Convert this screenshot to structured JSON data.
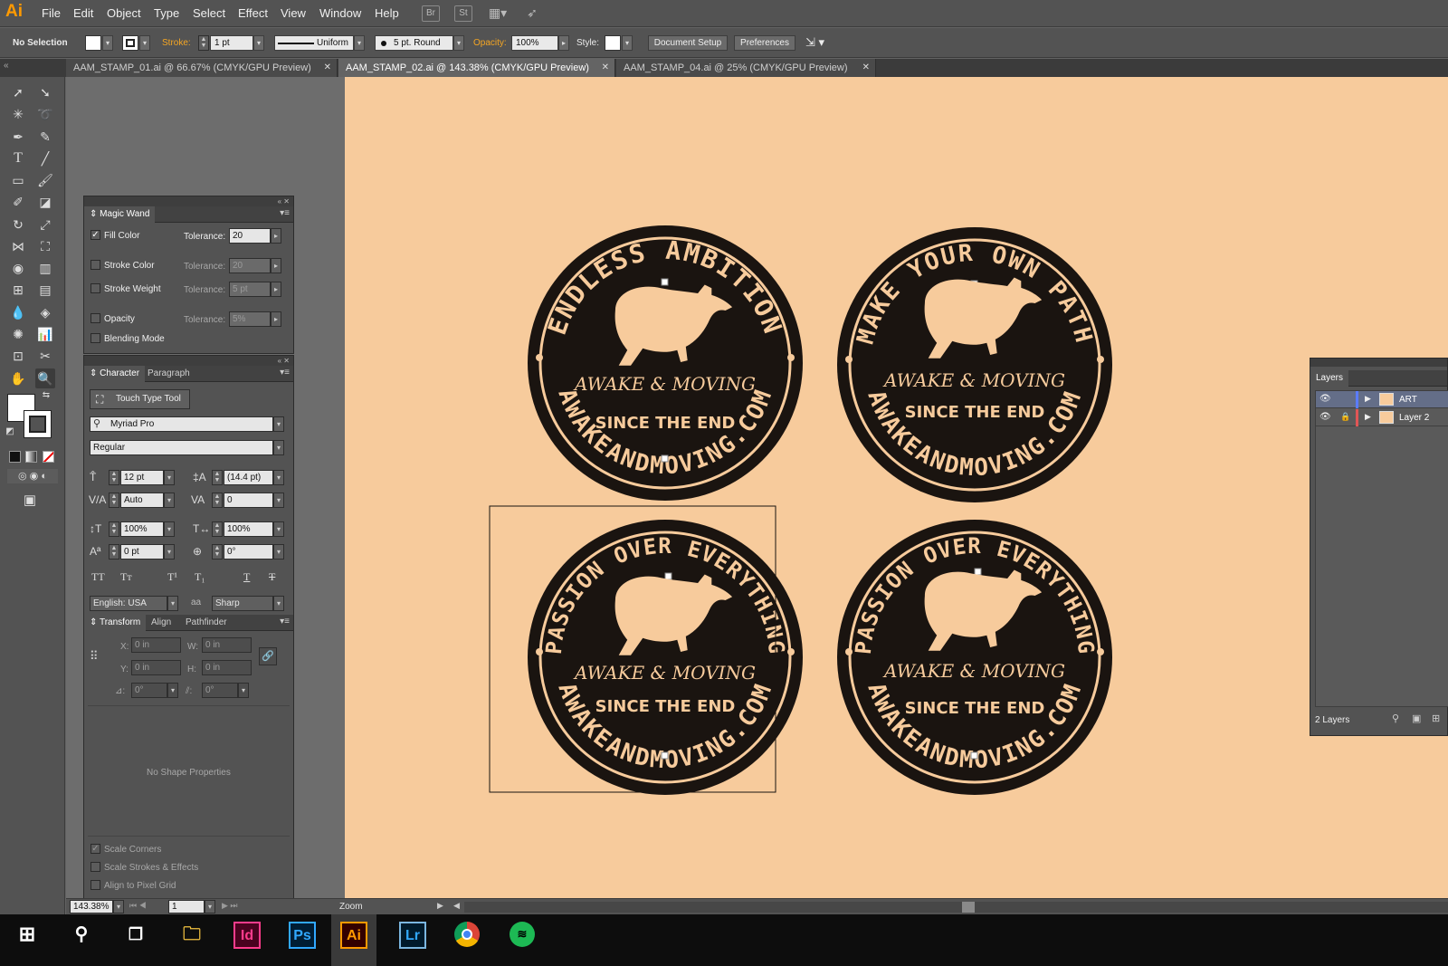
{
  "app": {
    "logo": "Ai"
  },
  "menu": [
    "File",
    "Edit",
    "Object",
    "Type",
    "Select",
    "Effect",
    "View",
    "Window",
    "Help"
  ],
  "menubar_icons": {
    "bridge": "Br",
    "stock": "St"
  },
  "control": {
    "selection": "No Selection",
    "stroke_label": "Stroke:",
    "stroke_weight": "1 pt",
    "profile": "Uniform",
    "brush": "5 pt. Round",
    "opacity_label": "Opacity:",
    "opacity": "100%",
    "style_label": "Style:",
    "doc_setup": "Document Setup",
    "preferences": "Preferences"
  },
  "tabs": [
    {
      "label": "AAM_STAMP_01.ai @ 66.67% (CMYK/GPU Preview)"
    },
    {
      "label": "AAM_STAMP_02.ai @ 143.38% (CMYK/GPU Preview)"
    },
    {
      "label": "AAM_STAMP_04.ai @ 25% (CMYK/GPU Preview)"
    }
  ],
  "magic_wand": {
    "title": "Magic Wand",
    "fill_color": "Fill Color",
    "stroke_color": "Stroke Color",
    "stroke_weight": "Stroke Weight",
    "opacity": "Opacity",
    "blending_mode": "Blending Mode",
    "tolerance_label": "Tolerance:",
    "fill_tol": "20",
    "stroke_tol": "20",
    "weight_tol": "5 pt",
    "opacity_tol": "5%"
  },
  "character": {
    "tab_character": "Character",
    "tab_paragraph": "Paragraph",
    "touch_type": "Touch Type Tool",
    "font": "Myriad Pro",
    "style": "Regular",
    "size": "12 pt",
    "leading": "(14.4 pt)",
    "kerning": "Auto",
    "tracking": "0",
    "vscale": "100%",
    "hscale": "100%",
    "baseline": "0 pt",
    "rotation": "0°",
    "language": "English: USA",
    "antialias": "Sharp",
    "aa_label": "aa"
  },
  "transform": {
    "tab_transform": "Transform",
    "tab_align": "Align",
    "tab_pathfinder": "Pathfinder",
    "x_label": "X:",
    "x": "0 in",
    "y_label": "Y:",
    "y": "0 in",
    "w_label": "W:",
    "w": "0 in",
    "h_label": "H:",
    "h": "0 in",
    "angle": "0°",
    "shear": "0°",
    "no_shape": "No Shape Properties",
    "scale_corners": "Scale Corners",
    "scale_strokes": "Scale Strokes & Effects",
    "pixel_grid": "Align to Pixel Grid"
  },
  "layers": {
    "title": "Layers",
    "items": [
      {
        "name": "ART"
      },
      {
        "name": "Layer 2"
      }
    ],
    "count": "2 Layers"
  },
  "status": {
    "zoom": "143.38%",
    "artboard": "1",
    "tool": "Zoom"
  },
  "stamps": [
    {
      "top_text": "ENDLESS AMBITION",
      "script": "AWAKE & MOVING",
      "since": "SINCE THE END",
      "bottom": "AWAKEANDMOVING.COM"
    },
    {
      "top_text": "MAKE YOUR OWN PATH",
      "script": "AWAKE & MOVING",
      "since": "SINCE THE END",
      "bottom": "AWAKEANDMOVING.COM"
    },
    {
      "top_text": "PASSION OVER EVERYTHING",
      "script": "AWAKE & MOVING",
      "since": "SINCE THE END",
      "bottom": "AWAKEANDMOVING.COM"
    },
    {
      "top_text": "PASSION OVER EVERYTHING",
      "script": "AWAKE & MOVING",
      "since": "SINCE THE END",
      "bottom": "AWAKEANDMOVING.COM"
    }
  ],
  "taskbar": {
    "indesign": "Id",
    "photoshop": "Ps",
    "illustrator": "Ai",
    "lightroom": "Lr"
  },
  "colors": {
    "artboard": "#f7cb9c",
    "stamp": "#1a1410",
    "accent": "#ff9a00"
  }
}
